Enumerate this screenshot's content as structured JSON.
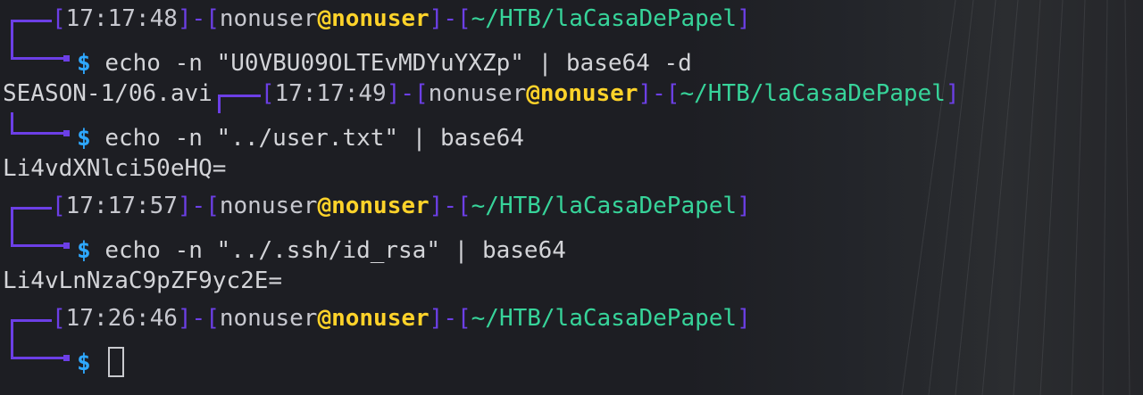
{
  "terminal": {
    "prompt_user": "nonuser",
    "prompt_at": "@",
    "prompt_host": "nonuser",
    "prompt_path": "~/HTB/laCasaDePapel",
    "prompt_dollar": "$",
    "blocks": [
      {
        "time": "17:17:48",
        "command": "echo -n \"U0VBU09OLTEvMDYuYXZp\" | base64 -d",
        "output": "SEASON-1/06.avi"
      },
      {
        "time": "17:17:49",
        "command": "echo -n \"../user.txt\" | base64",
        "output": "Li4vdXNlci50eHQ="
      },
      {
        "time": "17:17:57",
        "command": "echo -n \"../.ssh/id_rsa\" | base64",
        "output": "Li4vLnNzaC9pZF9yc2E="
      },
      {
        "time": "17:26:46",
        "command": "",
        "output": ""
      }
    ]
  },
  "colors": {
    "background": "#1d1e23",
    "bracket": "#6c3fe6",
    "host": "#ffd32a",
    "path": "#37d49a",
    "dollar": "#2ea8ff",
    "text": "#d3d4d8"
  }
}
